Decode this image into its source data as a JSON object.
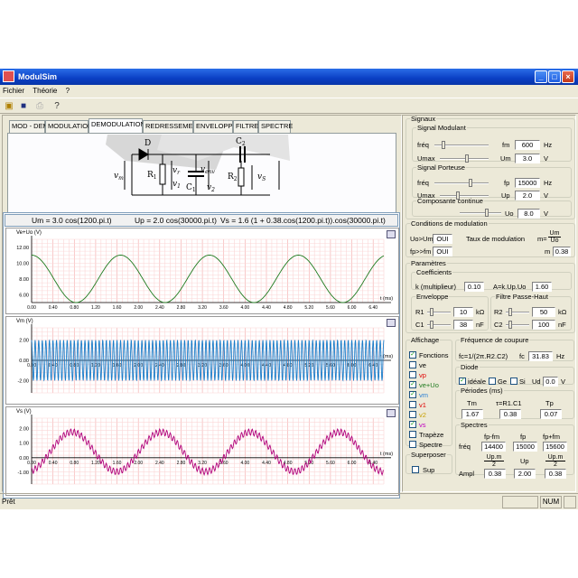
{
  "window": {
    "title": "ModulSim",
    "status": "Prêt",
    "status_panel": "NUM"
  },
  "menu": [
    "Fichier",
    "Théorie",
    "?"
  ],
  "tabs": [
    "MOD - DEM",
    "MODULATION",
    "DEMODULATION",
    "REDRESSEMENT",
    "ENVELOPPE",
    "FILTRE",
    "SPECTRE"
  ],
  "active_tab": "DEMODULATION",
  "circuit": {
    "labels": {
      "D": "D",
      "R1": "R",
      "R1_sub": "1",
      "C1": "C",
      "C1_sub": "1",
      "C2": "C",
      "C2_sub": "2",
      "R2": "R",
      "R2_sub": "2",
      "vm": "v",
      "vm_sub": "m",
      "vr": "v",
      "vr_sub": "r",
      "v1": "v",
      "v1_sub": "1",
      "venv": "v",
      "venv_sub": "env",
      "v2": "v",
      "v2_sub": "2",
      "vs": "v",
      "vs_sub": "S"
    }
  },
  "equations": {
    "um": "Um = 3.0 cos(1200.pi.t)",
    "up": "Up = 2.0 cos(30000.pi.t)",
    "vs": "Vs = 1.6 (1 + 0.38.cos(1200.pi.t)).cos(30000.pi.t)"
  },
  "plots": [
    {
      "title": "Ve+Uo (V)",
      "yticks": [
        "12.00",
        "10.00",
        "8.00",
        "6.00"
      ],
      "xlabel": "t (ms)",
      "color": "#1e7a1e"
    },
    {
      "title": "Vm (V)",
      "yticks": [
        "2.00",
        "0.00",
        "-2.00"
      ],
      "xlabel": "t (ms)",
      "color": "#1a7cc8"
    },
    {
      "title": "Vs (V)",
      "yticks": [
        "2.00",
        "1.00",
        "0.00",
        "-1.00"
      ],
      "xlabel": "t (ms)",
      "color": "#b0007a"
    }
  ],
  "xticks": [
    "0.00",
    "0.40",
    "0.80",
    "1.20",
    "1.60",
    "2.00",
    "2.40",
    "2.80",
    "3.20",
    "3.60",
    "4.00",
    "4.40",
    "4.80",
    "5.20",
    "5.60",
    "6.00",
    "6.40"
  ],
  "signaux": {
    "title": "Signaux",
    "modulant": {
      "title": "Signal Modulant",
      "freq_label": "fréq",
      "freq_sym": "fm",
      "freq": "600",
      "freq_unit": "Hz",
      "amp_label": "Umax",
      "amp_sym": "Um",
      "amp": "3.0",
      "amp_unit": "V"
    },
    "porteuse": {
      "title": "Signal Porteuse",
      "freq_label": "fréq",
      "freq_sym": "fp",
      "freq": "15000",
      "freq_unit": "Hz",
      "amp_label": "Umax",
      "amp_sym": "Up",
      "amp": "2.0",
      "amp_unit": "V"
    },
    "continue": {
      "title": "Composante continue",
      "sym": "Uo",
      "value": "8.0",
      "unit": "V"
    }
  },
  "conditions": {
    "title": "Conditions de modulation",
    "r1_label": "Uo>Um",
    "r1_value": "OUI",
    "r2_label": "fp>>fm",
    "r2_value": "OUI",
    "taux_label": "Taux de modulation",
    "taux_sym": "m=",
    "taux_num": "Um",
    "taux_den": "Uo",
    "m_label": "m",
    "m_value": "0.38"
  },
  "parametres": {
    "title": "Paramètres",
    "coef_title": "Coefficients",
    "k_label": "k (multiplieur)",
    "k_value": "0.10",
    "a_label": "A=k.Up.Uo",
    "a_value": "1.60",
    "env_title": "Enveloppe",
    "r1_label": "R1",
    "r1_value": "10",
    "r1_unit": "kΩ",
    "c1_label": "C1",
    "c1_value": "38",
    "c1_unit": "nF",
    "filt_title": "Filtre Passe-Haut",
    "r2_label": "R2",
    "r2_value": "50",
    "r2_unit": "kΩ",
    "c2_label": "C2",
    "c2_value": "100",
    "c2_unit": "nF"
  },
  "affichage": {
    "title": "Affichage",
    "items": [
      {
        "label": "Fonctions",
        "checked": true,
        "color": "#000000"
      },
      {
        "label": "ve",
        "checked": false,
        "color": "#000000"
      },
      {
        "label": "vp",
        "checked": false,
        "color": "#e00000"
      },
      {
        "label": "ve+Uo",
        "checked": true,
        "color": "#1e7a1e"
      },
      {
        "label": "vm",
        "checked": true,
        "color": "#2a7fd4"
      },
      {
        "label": "v1",
        "checked": false,
        "color": "#e00000"
      },
      {
        "label": "v2",
        "checked": false,
        "color": "#c8a000"
      },
      {
        "label": "vs",
        "checked": true,
        "color": "#c000c0"
      },
      {
        "label": "Trapèze",
        "checked": false,
        "color": "#000000"
      },
      {
        "label": "Spectre",
        "checked": false,
        "color": "#000000"
      }
    ]
  },
  "superposer": {
    "title": "Superposer",
    "label": "Sup",
    "checked": false
  },
  "coupure": {
    "title": "Fréquence de coupure",
    "formula": "fc=1/(2π.R2.C2)",
    "fc_label": "fc",
    "fc_value": "31.83",
    "fc_unit": "Hz"
  },
  "diode": {
    "title": "Diode",
    "ideale": "idéale",
    "ge": "Ge",
    "si": "Si",
    "ud_label": "Ud",
    "ud_value": "0.0",
    "ud_unit": "V"
  },
  "periodes": {
    "title": "Périodes (ms)",
    "tm_label": "Tm",
    "tm_value": "1.67",
    "tau_label": "τ=R1.C1",
    "tau_value": "0.38",
    "tp_label": "Tp",
    "tp_value": "0.07"
  },
  "spectres": {
    "title": "Spectres",
    "h1": "fp-fm",
    "h2": "fp",
    "h3": "fp+fm",
    "freq_label": "fréq",
    "f1": "14400",
    "f2": "15000",
    "f3": "15600",
    "a1_num": "Up.m",
    "a1_den": "2",
    "a2": "Up",
    "a3_num": "Up.m",
    "a3_den": "2",
    "ampl_label": "Ampl",
    "v1": "0.38",
    "v2": "2.00",
    "v3": "0.38"
  }
}
